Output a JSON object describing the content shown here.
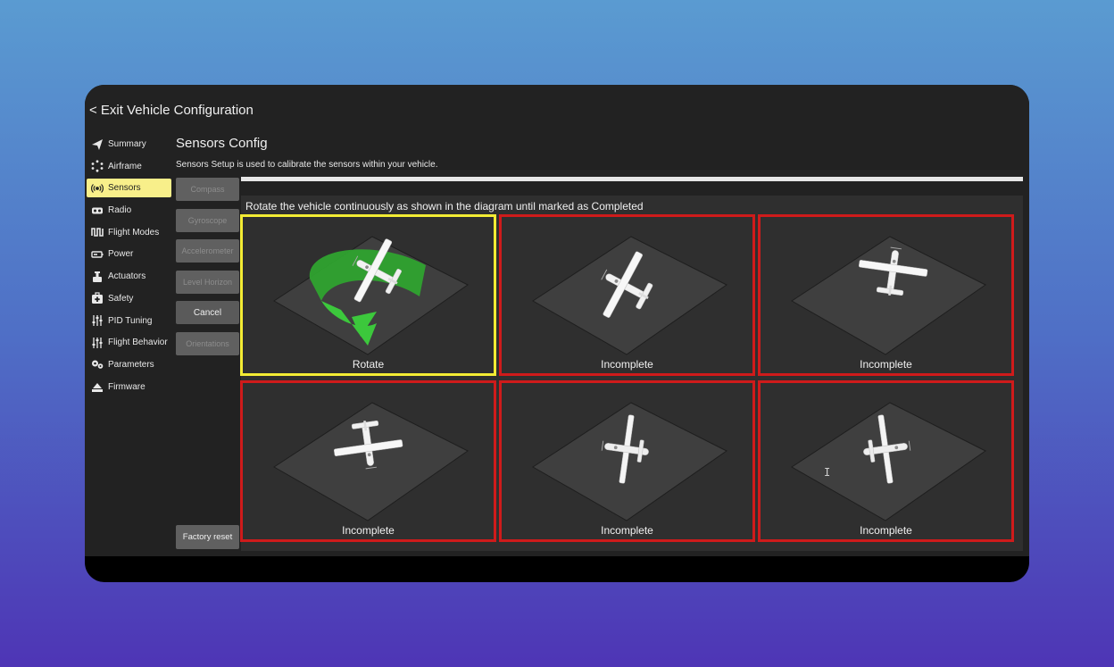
{
  "header": {
    "exit_label": "< Exit Vehicle Configuration"
  },
  "sidebar": {
    "items": [
      {
        "label": "Summary",
        "icon": "paper-plane-icon"
      },
      {
        "label": "Airframe",
        "icon": "airframe-icon"
      },
      {
        "label": "Sensors",
        "icon": "sensor-wave-icon",
        "active": true
      },
      {
        "label": "Radio",
        "icon": "radio-icon"
      },
      {
        "label": "Flight Modes",
        "icon": "waveform-icon"
      },
      {
        "label": "Power",
        "icon": "battery-icon"
      },
      {
        "label": "Actuators",
        "icon": "actuator-icon"
      },
      {
        "label": "Safety",
        "icon": "first-aid-icon"
      },
      {
        "label": "PID Tuning",
        "icon": "sliders-icon"
      },
      {
        "label": "Flight Behavior",
        "icon": "sliders-icon"
      },
      {
        "label": "Parameters",
        "icon": "gears-icon"
      },
      {
        "label": "Firmware",
        "icon": "firmware-icon"
      }
    ]
  },
  "page": {
    "title": "Sensors Config",
    "description": "Sensors Setup is used to calibrate the sensors within your vehicle.",
    "progress": 1.0
  },
  "calibration_buttons": [
    {
      "label": "Compass",
      "enabled": false
    },
    {
      "label": "Gyroscope",
      "enabled": false
    },
    {
      "label": "Accelerometer",
      "enabled": false
    },
    {
      "label": "Level Horizon",
      "enabled": false
    },
    {
      "label": "Cancel",
      "enabled": true
    },
    {
      "label": "Orientations",
      "enabled": false
    }
  ],
  "factory_reset_label": "Factory reset",
  "panel": {
    "instruction": "Rotate the vehicle continuously as shown in the diagram until marked as Completed",
    "cells": [
      {
        "label": "Rotate",
        "state": "active",
        "orientation": "rotate"
      },
      {
        "label": "Incomplete",
        "state": "incomplete",
        "orientation": "upright"
      },
      {
        "label": "Incomplete",
        "state": "incomplete",
        "orientation": "nose-down"
      },
      {
        "label": "Incomplete",
        "state": "incomplete",
        "orientation": "tail-down"
      },
      {
        "label": "Incomplete",
        "state": "incomplete",
        "orientation": "left-side"
      },
      {
        "label": "Incomplete",
        "state": "incomplete",
        "orientation": "right-side"
      }
    ]
  },
  "colors": {
    "active_border": "#f3ec34",
    "incomplete_border": "#cf1b1b",
    "sidebar_active": "#f8ef8a",
    "rotate_arrow": "#2fb52f"
  }
}
